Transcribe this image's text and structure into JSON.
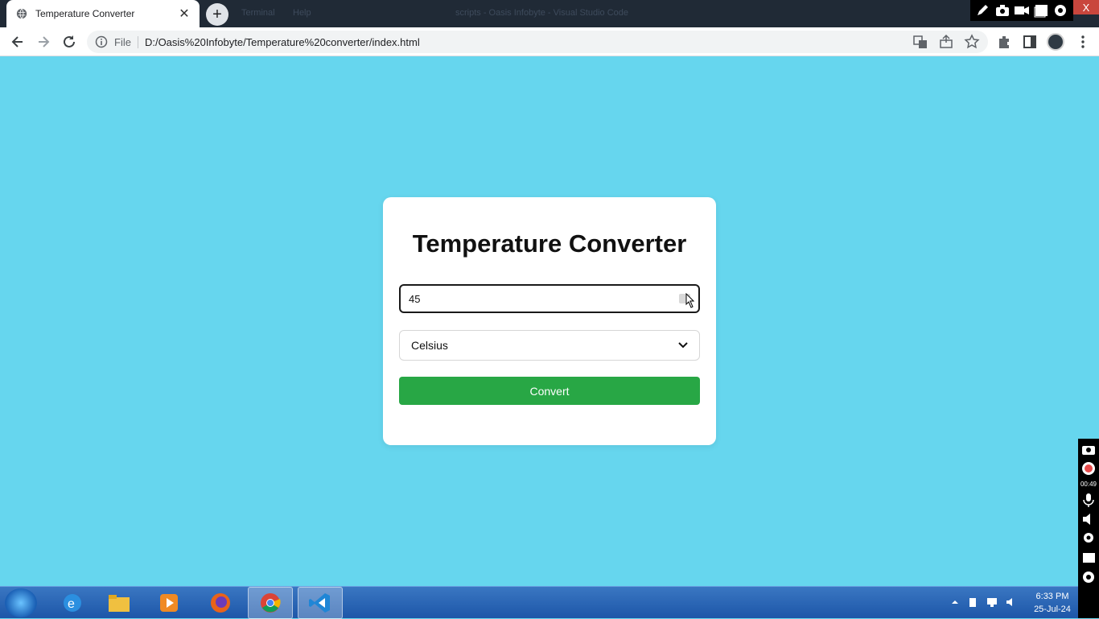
{
  "browser": {
    "tab_title": "Temperature Converter",
    "ghost_items": [
      "Terminal",
      "Help",
      "scripts - Oasis Infobyte - Visual Studio Code"
    ],
    "omnibox_scheme": "File",
    "url": "D:/Oasis%20Infobyte/Temperature%20converter/index.html",
    "close_glyph": "X"
  },
  "page": {
    "heading": "Temperature Converter",
    "input_value": "45",
    "unit_selected": "Celsius",
    "convert_label": "Convert"
  },
  "recorder": {
    "timer": "00:49"
  },
  "taskbar": {
    "time": "6:33 PM",
    "date": "25-Jul-24"
  },
  "colors": {
    "background": "#66d6ee",
    "button": "#28a745",
    "card": "#ffffff"
  }
}
